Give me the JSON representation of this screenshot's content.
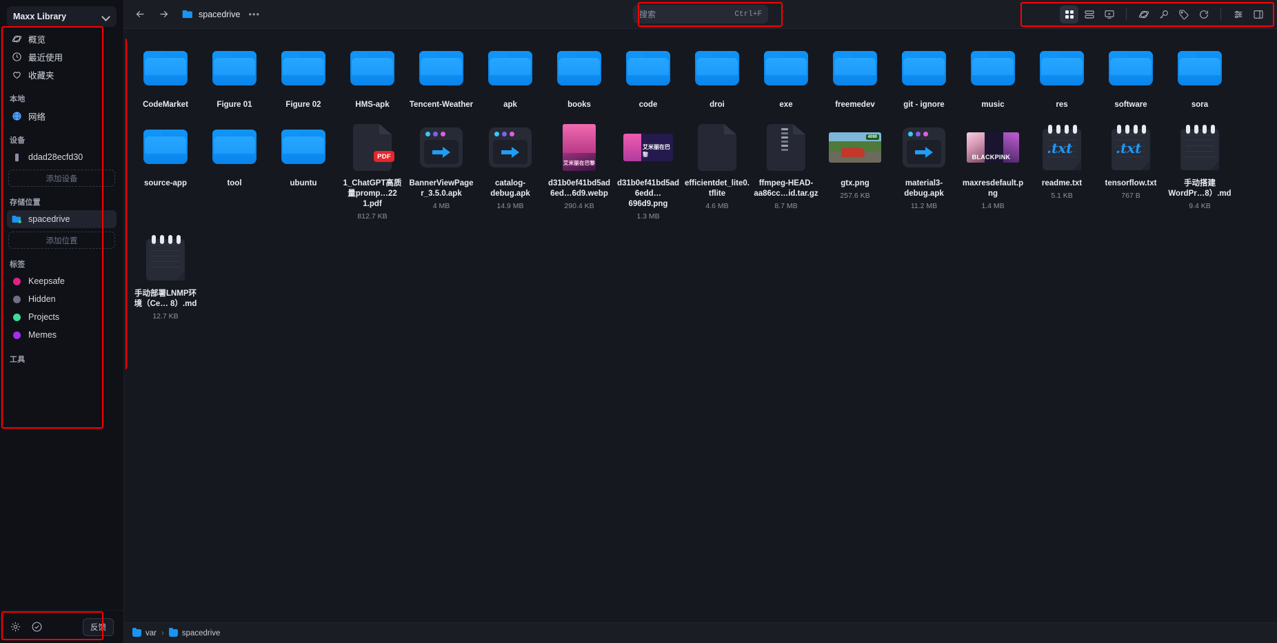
{
  "sidebar": {
    "library_name": "Maxx Library",
    "nav": [
      {
        "label": "概览",
        "icon": "planet-icon"
      },
      {
        "label": "最近使用",
        "icon": "clock-icon"
      },
      {
        "label": "收藏夹",
        "icon": "heart-icon"
      }
    ],
    "local_title": "本地",
    "local_items": [
      {
        "label": "网络",
        "icon": "globe-icon"
      }
    ],
    "devices_title": "设备",
    "devices": [
      {
        "label": "ddad28ecfd30",
        "icon": "device-icon"
      }
    ],
    "add_device_label": "添加设备",
    "locations_title": "存储位置",
    "locations": [
      {
        "label": "spacedrive",
        "icon": "folder-icon",
        "active": true
      }
    ],
    "add_location_label": "添加位置",
    "tags_title": "标签",
    "tags": [
      {
        "label": "Keepsafe",
        "color": "#e0218a"
      },
      {
        "label": "Hidden",
        "color": "#6e7183"
      },
      {
        "label": "Projects",
        "color": "#3ddc97"
      },
      {
        "label": "Memes",
        "color": "#a82cf0"
      }
    ],
    "tools_title": "工具",
    "bottom": {
      "settings_icon": "gear-icon",
      "status_icon": "check-circle-icon",
      "feedback_label": "反馈"
    }
  },
  "topbar": {
    "back_icon": "arrow-left-icon",
    "forward_icon": "arrow-right-icon",
    "path_label": "spacedrive",
    "overflow_label": "•••",
    "search": {
      "placeholder": "搜索",
      "shortcut": "Ctrl+F"
    },
    "tools": [
      {
        "name": "grid-view-icon",
        "selected": true
      },
      {
        "name": "list-view-icon",
        "selected": false
      },
      {
        "name": "media-view-icon",
        "selected": false
      },
      {
        "name": "separator",
        "selected": false
      },
      {
        "name": "planet-icon",
        "selected": false
      },
      {
        "name": "key-icon",
        "selected": false
      },
      {
        "name": "tag-icon",
        "selected": false
      },
      {
        "name": "refresh-icon",
        "selected": false
      },
      {
        "name": "separator",
        "selected": false
      },
      {
        "name": "options-icon",
        "selected": false
      },
      {
        "name": "inspector-icon",
        "selected": false
      }
    ]
  },
  "files": [
    {
      "name": "CodeMarket",
      "size": "",
      "kind": "folder"
    },
    {
      "name": "Figure 01",
      "size": "",
      "kind": "folder"
    },
    {
      "name": "Figure 02",
      "size": "",
      "kind": "folder"
    },
    {
      "name": "HMS-apk",
      "size": "",
      "kind": "folder"
    },
    {
      "name": "Tencent-Weather",
      "size": "",
      "kind": "folder"
    },
    {
      "name": "apk",
      "size": "",
      "kind": "folder"
    },
    {
      "name": "books",
      "size": "",
      "kind": "folder"
    },
    {
      "name": "code",
      "size": "",
      "kind": "folder"
    },
    {
      "name": "droi",
      "size": "",
      "kind": "folder"
    },
    {
      "name": "exe",
      "size": "",
      "kind": "folder"
    },
    {
      "name": "freemedev",
      "size": "",
      "kind": "folder"
    },
    {
      "name": "git - ignore",
      "size": "",
      "kind": "folder"
    },
    {
      "name": "music",
      "size": "",
      "kind": "folder"
    },
    {
      "name": "res",
      "size": "",
      "kind": "folder"
    },
    {
      "name": "software",
      "size": "",
      "kind": "folder"
    },
    {
      "name": "sora",
      "size": "",
      "kind": "folder"
    },
    {
      "name": "source-app",
      "size": "",
      "kind": "folder"
    },
    {
      "name": "tool",
      "size": "",
      "kind": "folder"
    },
    {
      "name": "ubuntu",
      "size": "",
      "kind": "folder"
    },
    {
      "name": "1_ChatGPT高质量promp…22 1.pdf",
      "size": "812.7 KB",
      "kind": "pdf"
    },
    {
      "name": "BannerViewPager_3.5.0.apk",
      "size": "4 MB",
      "kind": "apk"
    },
    {
      "name": "catalog-debug.apk",
      "size": "14.9 MB",
      "kind": "apk"
    },
    {
      "name": "d31b0ef41bd5ad6ed…6d9.webp",
      "size": "290.4 KB",
      "kind": "image-poster"
    },
    {
      "name": "d31b0ef41bd5ad6edd…696d9.png",
      "size": "1.3 MB",
      "kind": "image-banner"
    },
    {
      "name": "efficientdet_lite0.tflite",
      "size": "4.6 MB",
      "kind": "file"
    },
    {
      "name": "ffmpeg-HEAD-aa86cc…id.tar.gz",
      "size": "8.7 MB",
      "kind": "archive"
    },
    {
      "name": "gtx.png",
      "size": "257.6 KB",
      "kind": "image-gtx"
    },
    {
      "name": "material3-debug.apk",
      "size": "11.2 MB",
      "kind": "apk"
    },
    {
      "name": "maxresdefault.png",
      "size": "1.4 MB",
      "kind": "image-bp"
    },
    {
      "name": "readme.txt",
      "size": "5.1 KB",
      "kind": "txt"
    },
    {
      "name": "tensorflow.txt",
      "size": "767 B",
      "kind": "txt"
    },
    {
      "name": "手动搭建WordPr…8）.md",
      "size": "9.4 KB",
      "kind": "note"
    },
    {
      "name": "手动部署LNMP环境（Ce… 8）.md",
      "size": "12.7 KB",
      "kind": "note"
    }
  ],
  "footer": {
    "crumbs": [
      {
        "label": "var"
      },
      {
        "label": "spacedrive"
      }
    ],
    "separator": "›"
  },
  "annotations": {
    "accent": "#fe0000"
  }
}
